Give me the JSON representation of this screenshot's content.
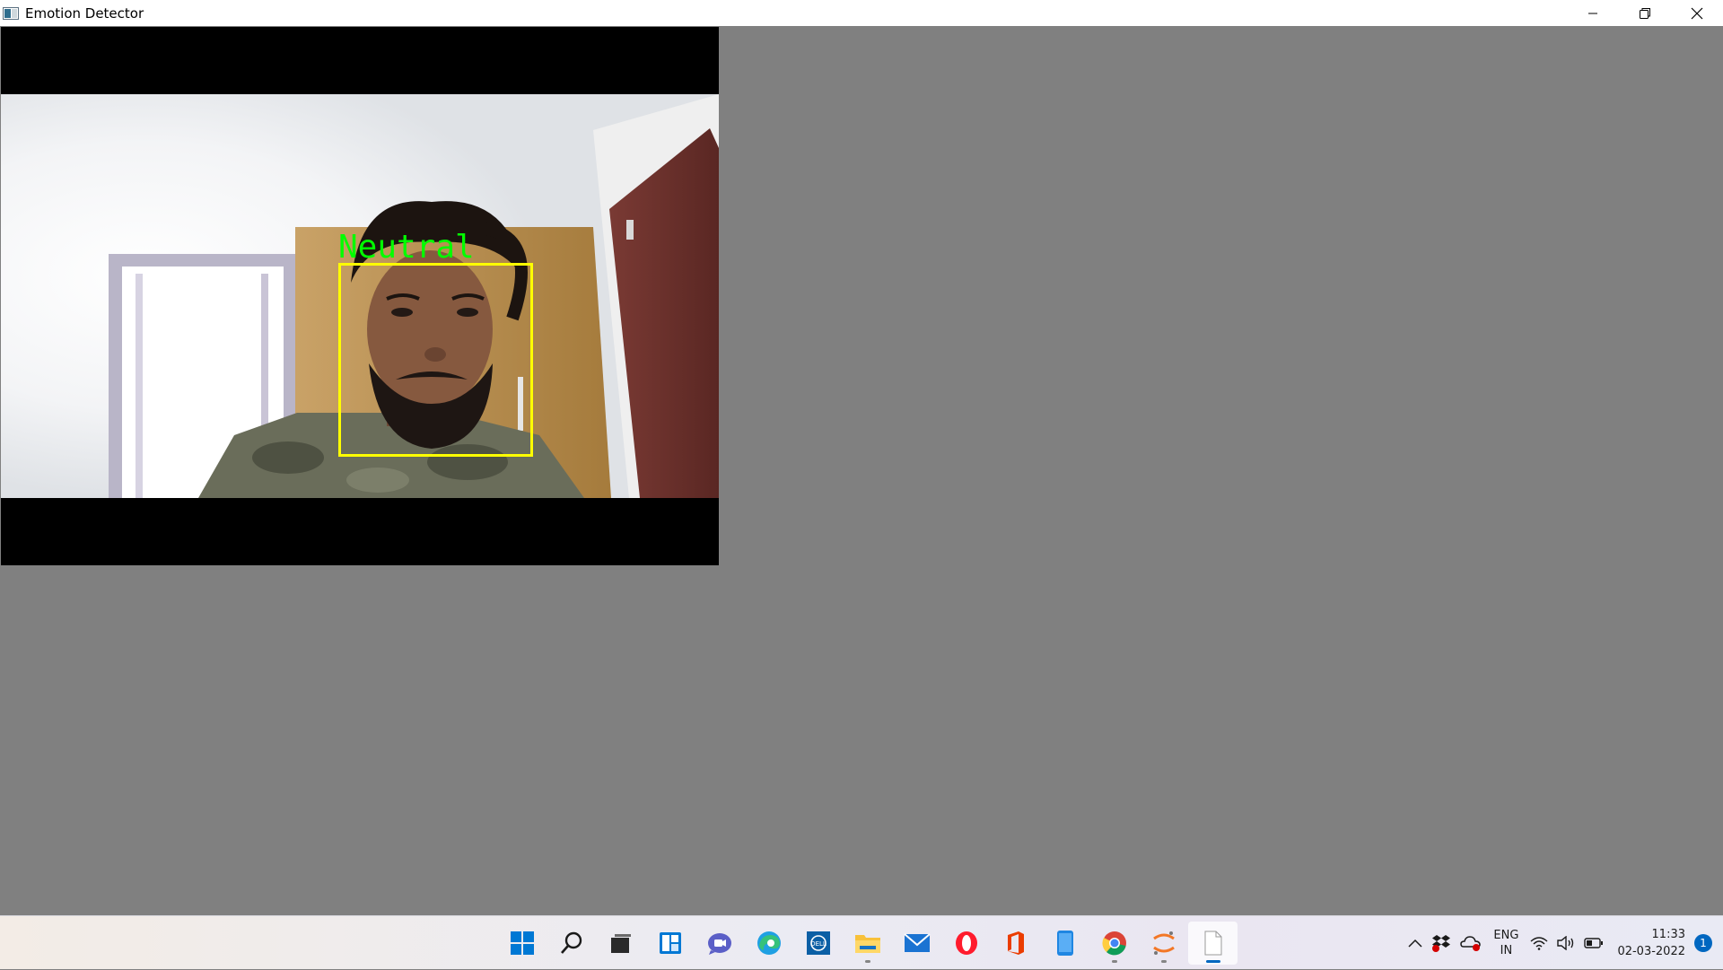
{
  "window": {
    "title": "Emotion Detector",
    "controls": [
      "minimize",
      "restore",
      "close"
    ]
  },
  "detection": {
    "emotion": "Neutral",
    "box_color": "#ffff00",
    "label_color": "#00ff00"
  },
  "colors": {
    "background": "#808080",
    "accent": "#0067c0"
  },
  "taskbar": {
    "apps": [
      {
        "name": "start-icon",
        "running": false
      },
      {
        "name": "search-icon",
        "running": false
      },
      {
        "name": "task-view-icon",
        "running": false
      },
      {
        "name": "widgets-icon",
        "running": false
      },
      {
        "name": "teams-chat-icon",
        "running": false
      },
      {
        "name": "edge-icon",
        "running": false
      },
      {
        "name": "dell-icon",
        "running": false
      },
      {
        "name": "file-explorer-icon",
        "running": true
      },
      {
        "name": "mail-icon",
        "running": false
      },
      {
        "name": "opera-icon",
        "running": false
      },
      {
        "name": "office-icon",
        "running": false
      },
      {
        "name": "phone-icon",
        "running": false
      },
      {
        "name": "chrome-icon",
        "running": true
      },
      {
        "name": "jupyter-icon",
        "running": true
      },
      {
        "name": "document-icon",
        "running": true,
        "active": true
      }
    ]
  },
  "tray": {
    "language_line1": "ENG",
    "language_line2": "IN",
    "time": "11:33",
    "date": "02-03-2022",
    "notification_count": "1"
  }
}
